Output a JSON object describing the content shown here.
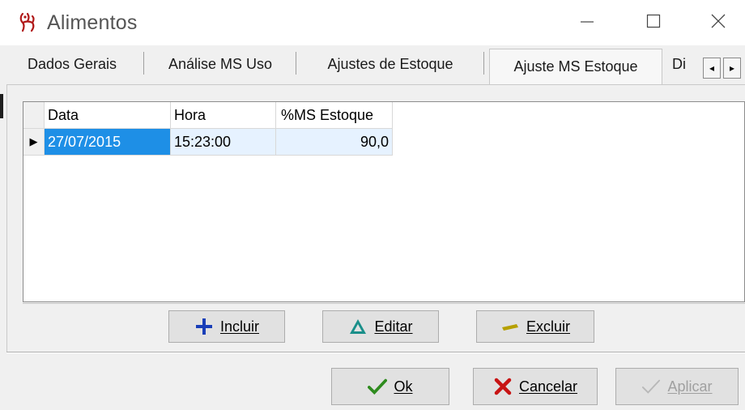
{
  "window": {
    "title": "Alimentos",
    "icon": "app-logo-icon",
    "controls": [
      "minimize-icon",
      "maximize-icon",
      "close-icon"
    ]
  },
  "tabs": [
    {
      "label": "Dados Gerais",
      "active": false
    },
    {
      "label": "Análise MS Uso",
      "active": false
    },
    {
      "label": "Ajustes de Estoque",
      "active": false
    },
    {
      "label": "Ajuste MS Estoque",
      "active": true
    },
    {
      "label": "Di",
      "active": false
    }
  ],
  "tab_scroll": {
    "left": "◂",
    "right": "▸"
  },
  "grid": {
    "columns": [
      "Data",
      "Hora",
      "%MS Estoque"
    ],
    "rows": [
      {
        "indicator": "▶",
        "data": "27/07/2015",
        "hora": "15:23:00",
        "ms_estoque": "90,0"
      }
    ]
  },
  "grid_buttons": {
    "incluir": {
      "label": "Incluir",
      "icon": "plus-cross-icon"
    },
    "editar": {
      "label": "Editar",
      "icon": "triangle-icon"
    },
    "excluir": {
      "label": "Excluir",
      "icon": "minus-bar-icon"
    }
  },
  "dialog_buttons": {
    "ok": {
      "label": "Ok",
      "icon": "check-icon"
    },
    "cancelar": {
      "label": "Cancelar",
      "icon": "x-icon"
    },
    "aplicar": {
      "label": "Aplicar",
      "icon": "check-disabled-icon",
      "enabled": false
    }
  },
  "colors": {
    "selection": "#1e8fe6",
    "alt_row": "#e6f2ff",
    "icon_blue": "#1a3fb8",
    "icon_teal": "#1a8f8a",
    "icon_yellow": "#b6a000",
    "icon_green": "#2e8b1e",
    "icon_red": "#c81414"
  }
}
